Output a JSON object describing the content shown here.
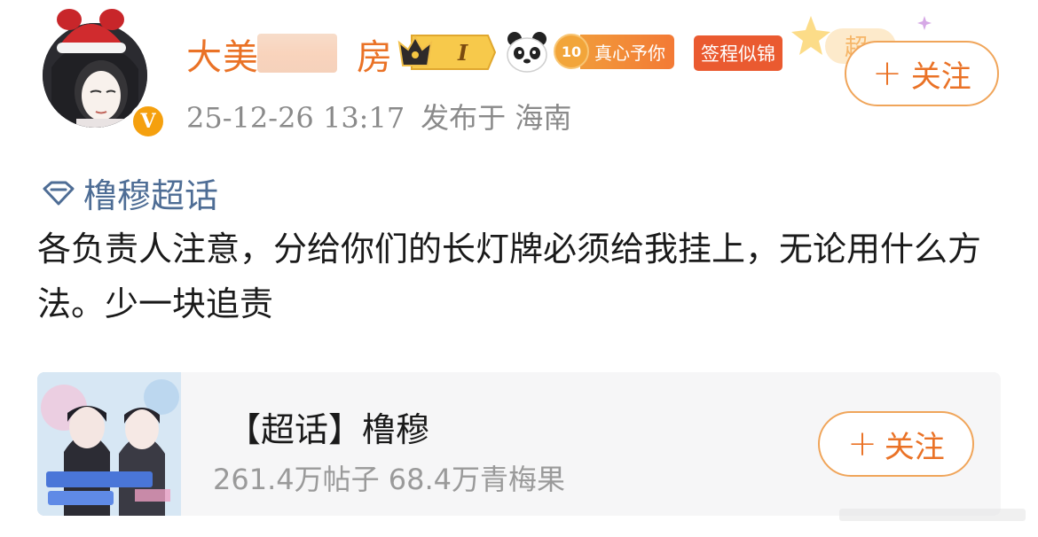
{
  "user": {
    "name_left": "大美",
    "name_right": "房",
    "post_time": "25-12-26 13:17",
    "post_location": "发布于 海南",
    "verified_mark": "V"
  },
  "badges": {
    "crown_level": "I",
    "heart_level": "10",
    "heart_label": "真心予你",
    "sign_label": "签程似锦",
    "sparkle_label": "超"
  },
  "follow_button": {
    "label": "关注",
    "plus": "+"
  },
  "post": {
    "topic": "橹穆超话",
    "text": "各负责人注意，分给你们的长灯牌必须给我挂上，无论用什么方法。少一块追责"
  },
  "card": {
    "title": "【超话】橹穆",
    "stats": "261.4万帖子 68.4万青梅果",
    "follow_label": "关注",
    "follow_plus": "+"
  },
  "colors": {
    "accent": "#ea7226",
    "topic": "#4e6d95",
    "meta": "#8a8a8a",
    "verified": "#f5a00e"
  },
  "icons": {
    "topic": "diamond-icon",
    "verified": "verified-v-icon",
    "crown": "crown-icon",
    "panda": "panda-icon"
  }
}
